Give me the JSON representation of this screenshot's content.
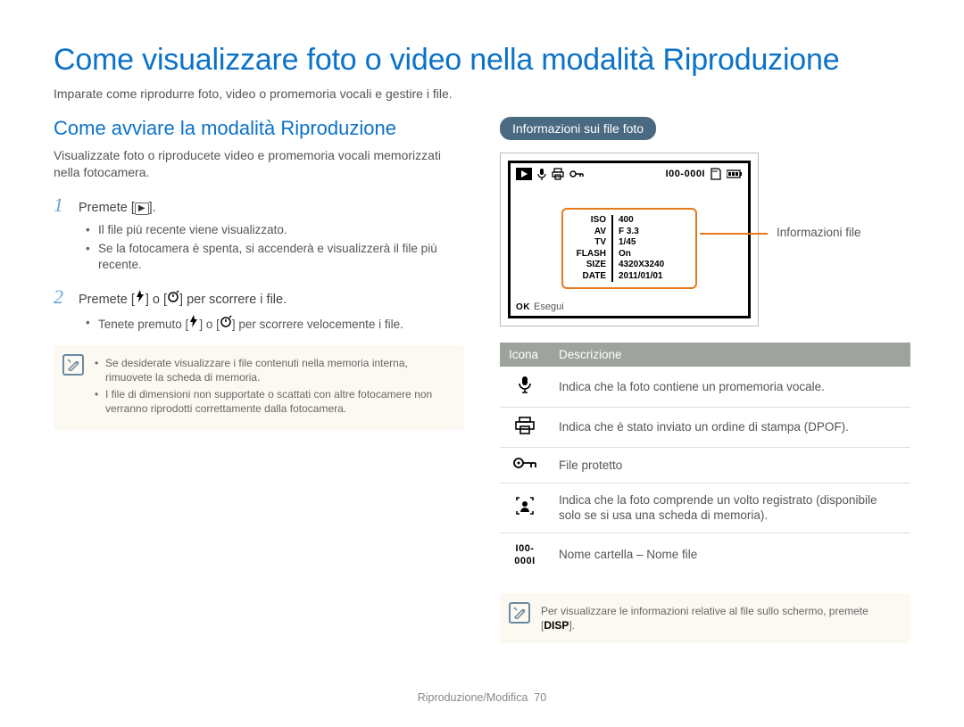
{
  "title": "Come visualizzare foto o video nella modalità Riproduzione",
  "intro": "Imparate come riprodurre foto, video o promemoria vocali e gestire i file.",
  "left": {
    "heading": "Come avviare la modalità Riproduzione",
    "paragraph": "Visualizzate foto o riproducete video e promemoria vocali memorizzati nella fotocamera.",
    "step1": {
      "num": "1",
      "pre": "Premete [",
      "icon_name": "playback-icon",
      "post": "]."
    },
    "step1_bullets": [
      "Il file più recente viene visualizzato.",
      "Se la fotocamera è spenta, si accenderà e visualizzerà il file più recente."
    ],
    "step2": {
      "num": "2",
      "pre": "Premete [",
      "mid": "] o [",
      "post": "] per scorrere i file."
    },
    "step2_bullets_pre": "Tenete premuto [",
    "step2_bullets_mid": "] o [",
    "step2_bullets_post": "] per scorrere velocemente i file.",
    "notes": [
      "Se desiderate visualizzare i file contenuti nella memoria interna, rimuovete la scheda di memoria.",
      "I file di dimensioni non supportate o scattati con altre fotocamere non verranno riprodotti correttamente dalla fotocamera."
    ]
  },
  "right": {
    "pill": "Informazioni sui file foto",
    "pointer_label": "Informazioni file",
    "screen": {
      "file_counter": "I00-000I",
      "footer_ok": "OK",
      "footer_label": "Esegui",
      "info": [
        {
          "k": "ISO",
          "v": "400"
        },
        {
          "k": "AV",
          "v": "F 3.3"
        },
        {
          "k": "TV",
          "v": "1/45"
        },
        {
          "k": "FLASH",
          "v": "On"
        },
        {
          "k": "SIZE",
          "v": "4320X3240"
        },
        {
          "k": "DATE",
          "v": "2011/01/01"
        }
      ]
    },
    "table": {
      "h1": "Icona",
      "h2": "Descrizione",
      "rows": [
        {
          "icon": "mic",
          "desc": "Indica che la foto contiene un promemoria vocale."
        },
        {
          "icon": "print",
          "desc": "Indica che è stato inviato un ordine di stampa (DPOF)."
        },
        {
          "icon": "key",
          "desc": "File protetto"
        },
        {
          "icon": "face",
          "desc": "Indica che la foto comprende un volto registrato (disponibile solo se si usa una scheda di memoria)."
        },
        {
          "icon": "folderfile",
          "label": "I00-000I",
          "desc": "Nome cartella – Nome file"
        }
      ]
    },
    "note_pre": "Per visualizzare le informazioni relative al file sullo schermo, premete [",
    "note_btn": "DISP",
    "note_post": "]."
  },
  "footer": {
    "section": "Riproduzione/Modifica",
    "page": "70"
  }
}
